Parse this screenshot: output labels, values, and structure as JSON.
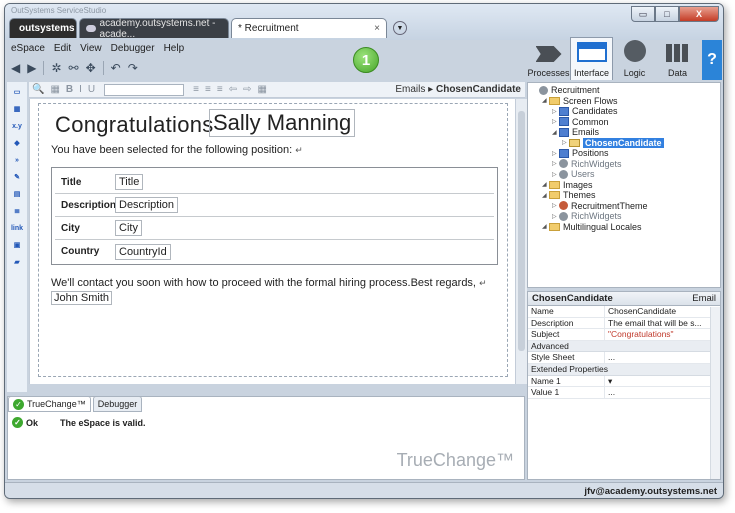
{
  "window": {
    "title": "OutSystems ServiceStudio",
    "controls": {
      "minimize": "▭",
      "maximize": "□",
      "close": "X"
    }
  },
  "tabs": {
    "logo": "outsystems",
    "site": "academy.outsystems.net - acade...",
    "active": "* Recruitment",
    "close": "×"
  },
  "menu": [
    "eSpace",
    "Edit",
    "View",
    "Debugger",
    "Help"
  ],
  "step_badge": "1",
  "layers": [
    {
      "label": "Processes",
      "icon": "processes-icon"
    },
    {
      "label": "Interface",
      "icon": "interface-icon"
    },
    {
      "label": "Logic",
      "icon": "logic-icon"
    },
    {
      "label": "Data",
      "icon": "data-icon"
    }
  ],
  "help": "?",
  "editor": {
    "breadcrumb_parent": "Emails",
    "breadcrumb_sep": "▸",
    "breadcrumb_current": "ChosenCandidate",
    "congrats": "Congratulations",
    "candidate": "Sally Manning",
    "intro": "You have been selected for the following position:",
    "rows": [
      {
        "label": "Title",
        "value": "Title"
      },
      {
        "label": "Description",
        "value": "Description"
      },
      {
        "label": "City",
        "value": "City"
      },
      {
        "label": "Country",
        "value": "CountryId"
      }
    ],
    "outro": "We'll contact you soon with how to proceed with the formal hiring process.Best regards,",
    "signature": "John Smith",
    "return_glyph": "↵"
  },
  "tree": [
    {
      "label": "Recruitment",
      "depth": 0,
      "icon": "globe"
    },
    {
      "label": "Screen Flows",
      "depth": 1,
      "icon": "folder"
    },
    {
      "label": "Candidates",
      "depth": 2,
      "icon": "flow"
    },
    {
      "label": "Common",
      "depth": 2,
      "icon": "flow"
    },
    {
      "label": "Emails",
      "depth": 2,
      "icon": "flow"
    },
    {
      "label": "ChosenCandidate",
      "depth": 3,
      "icon": "email",
      "selected": true
    },
    {
      "label": "Positions",
      "depth": 2,
      "icon": "flow"
    },
    {
      "label": "RichWidgets",
      "depth": 2,
      "icon": "globe",
      "gray": true
    },
    {
      "label": "Users",
      "depth": 2,
      "icon": "globe",
      "gray": true
    },
    {
      "label": "Images",
      "depth": 1,
      "icon": "folder"
    },
    {
      "label": "Themes",
      "depth": 1,
      "icon": "folder"
    },
    {
      "label": "RecruitmentTheme",
      "depth": 2,
      "icon": "theme"
    },
    {
      "label": "RichWidgets",
      "depth": 2,
      "icon": "globe",
      "gray": true
    },
    {
      "label": "Multilingual Locales",
      "depth": 1,
      "icon": "folder"
    }
  ],
  "properties": {
    "name": "ChosenCandidate",
    "kind": "Email",
    "rows": [
      {
        "key": "Name",
        "value": "ChosenCandidate"
      },
      {
        "key": "Description",
        "value": "The email that will be s..."
      },
      {
        "key": "Subject",
        "value": "\"Congratulations\"",
        "red": true
      }
    ],
    "section_advanced": "Advanced",
    "advanced_rows": [
      {
        "key": "Style Sheet",
        "value": "..."
      }
    ],
    "section_extended": "Extended Properties",
    "extended_rows": [
      {
        "key": "Name 1",
        "value": "▾"
      },
      {
        "key": "Value 1",
        "value": "..."
      }
    ]
  },
  "bottom": {
    "tabs": [
      "TrueChange™",
      "Debugger"
    ],
    "status": "Ok",
    "message": "The eSpace is valid.",
    "brand": "TrueChange™"
  },
  "status_bar": {
    "user": "jfv@academy.outsystems.net"
  }
}
